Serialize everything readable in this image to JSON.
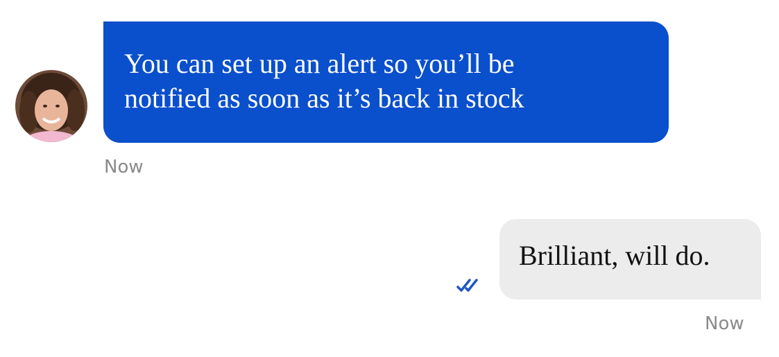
{
  "conversation": {
    "agent_message": {
      "avatar_icon": "agent-avatar-icon",
      "text": "You can set up an alert so you’ll be\nnotified as soon as it’s back in stock",
      "time": "Now",
      "bubble_color": "#0a4fcc"
    },
    "user_message": {
      "text": "Brilliant, will do.",
      "time": "Now",
      "status_icon": "double-check-icon",
      "bubble_color": "#ececec",
      "check_color": "#1f55c0"
    }
  }
}
